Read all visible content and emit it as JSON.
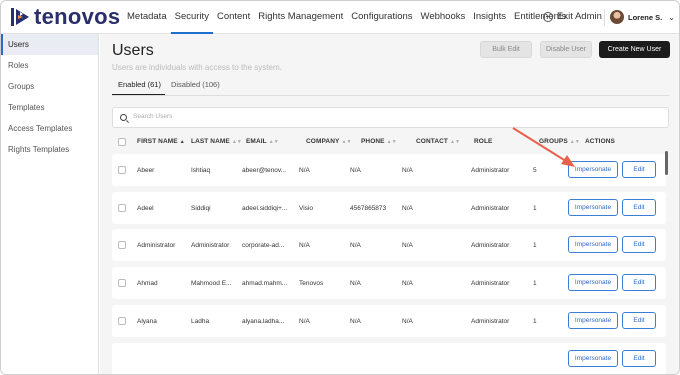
{
  "app": {
    "brand": "tenovos",
    "brand_color": "#2a2e6a",
    "accent_color": "#2a6bc9"
  },
  "nav": {
    "items": [
      {
        "label": "Metadata"
      },
      {
        "label": "Security"
      },
      {
        "label": "Content"
      },
      {
        "label": "Rights Management"
      },
      {
        "label": "Configurations"
      },
      {
        "label": "Webhooks"
      },
      {
        "label": "Insights"
      },
      {
        "label": "Entitlements"
      }
    ],
    "active": "Security",
    "exit_admin": "Exit Admin",
    "user_name": "Lorene S."
  },
  "sidebar": {
    "items": [
      {
        "label": "Users"
      },
      {
        "label": "Roles"
      },
      {
        "label": "Groups"
      },
      {
        "label": "Templates"
      },
      {
        "label": "Access Templates"
      },
      {
        "label": "Rights Templates"
      }
    ],
    "active": "Users"
  },
  "page": {
    "title": "Users",
    "subtitle": "Users are individuals with access to the system.",
    "bulk_edit": "Bulk Edit",
    "disable_user": "Disable User",
    "create_new_user": "Create New User",
    "tabs": [
      {
        "label": "Enabled (61)"
      },
      {
        "label": "Disabled (106)"
      }
    ],
    "search_placeholder": "Search Users"
  },
  "table": {
    "columns": [
      "FIRST NAME",
      "LAST NAME",
      "EMAIL",
      "COMPANY",
      "PHONE",
      "CONTACT",
      "ROLE",
      "GROUPS",
      "ACTIONS"
    ],
    "rows": [
      {
        "first": "Abeer",
        "last": "Ishtiaq",
        "email": "abeer@tenov...",
        "company": "N/A",
        "phone": "N/A",
        "contact": "N/A",
        "role": "Administrator",
        "groups": "5"
      },
      {
        "first": "Adeel",
        "last": "Siddiqi",
        "email": "adeel.siddiqi+...",
        "company": "Visio",
        "phone": "4567865873",
        "contact": "N/A",
        "role": "Administrator",
        "groups": "1"
      },
      {
        "first": "Administrator",
        "last": "Administrator",
        "email": "corporate-ad...",
        "company": "N/A",
        "phone": "N/A",
        "contact": "N/A",
        "role": "Administrator",
        "groups": "1"
      },
      {
        "first": "Ahmad",
        "last": "Mahmood E...",
        "email": "ahmad.mahm...",
        "company": "Tenovos",
        "phone": "N/A",
        "contact": "N/A",
        "role": "Administrator",
        "groups": "1"
      },
      {
        "first": "Alyana",
        "last": "Ladha",
        "email": "alyana.ladha...",
        "company": "N/A",
        "phone": "N/A",
        "contact": "N/A",
        "role": "Administrator",
        "groups": "1"
      }
    ],
    "impersonate_label": "Impersonate",
    "edit_label": "Edit"
  },
  "annotation": {
    "arrow_color": "#e8604c"
  }
}
